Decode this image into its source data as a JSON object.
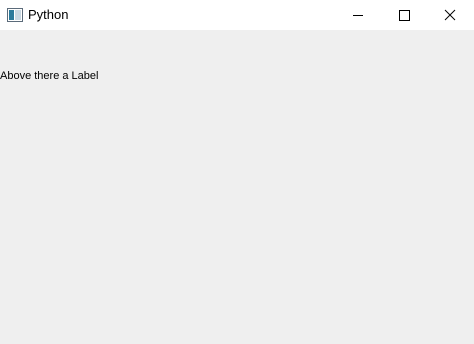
{
  "window": {
    "title": "Python",
    "icon": "python-app-icon",
    "controls": {
      "minimize_icon": "minimize-icon",
      "maximize_icon": "maximize-icon",
      "close_icon": "close-icon"
    }
  },
  "content": {
    "label_text": "Above there a Label"
  },
  "colors": {
    "titlebar": "#ffffff",
    "background": "#efefef",
    "text": "#000000"
  }
}
